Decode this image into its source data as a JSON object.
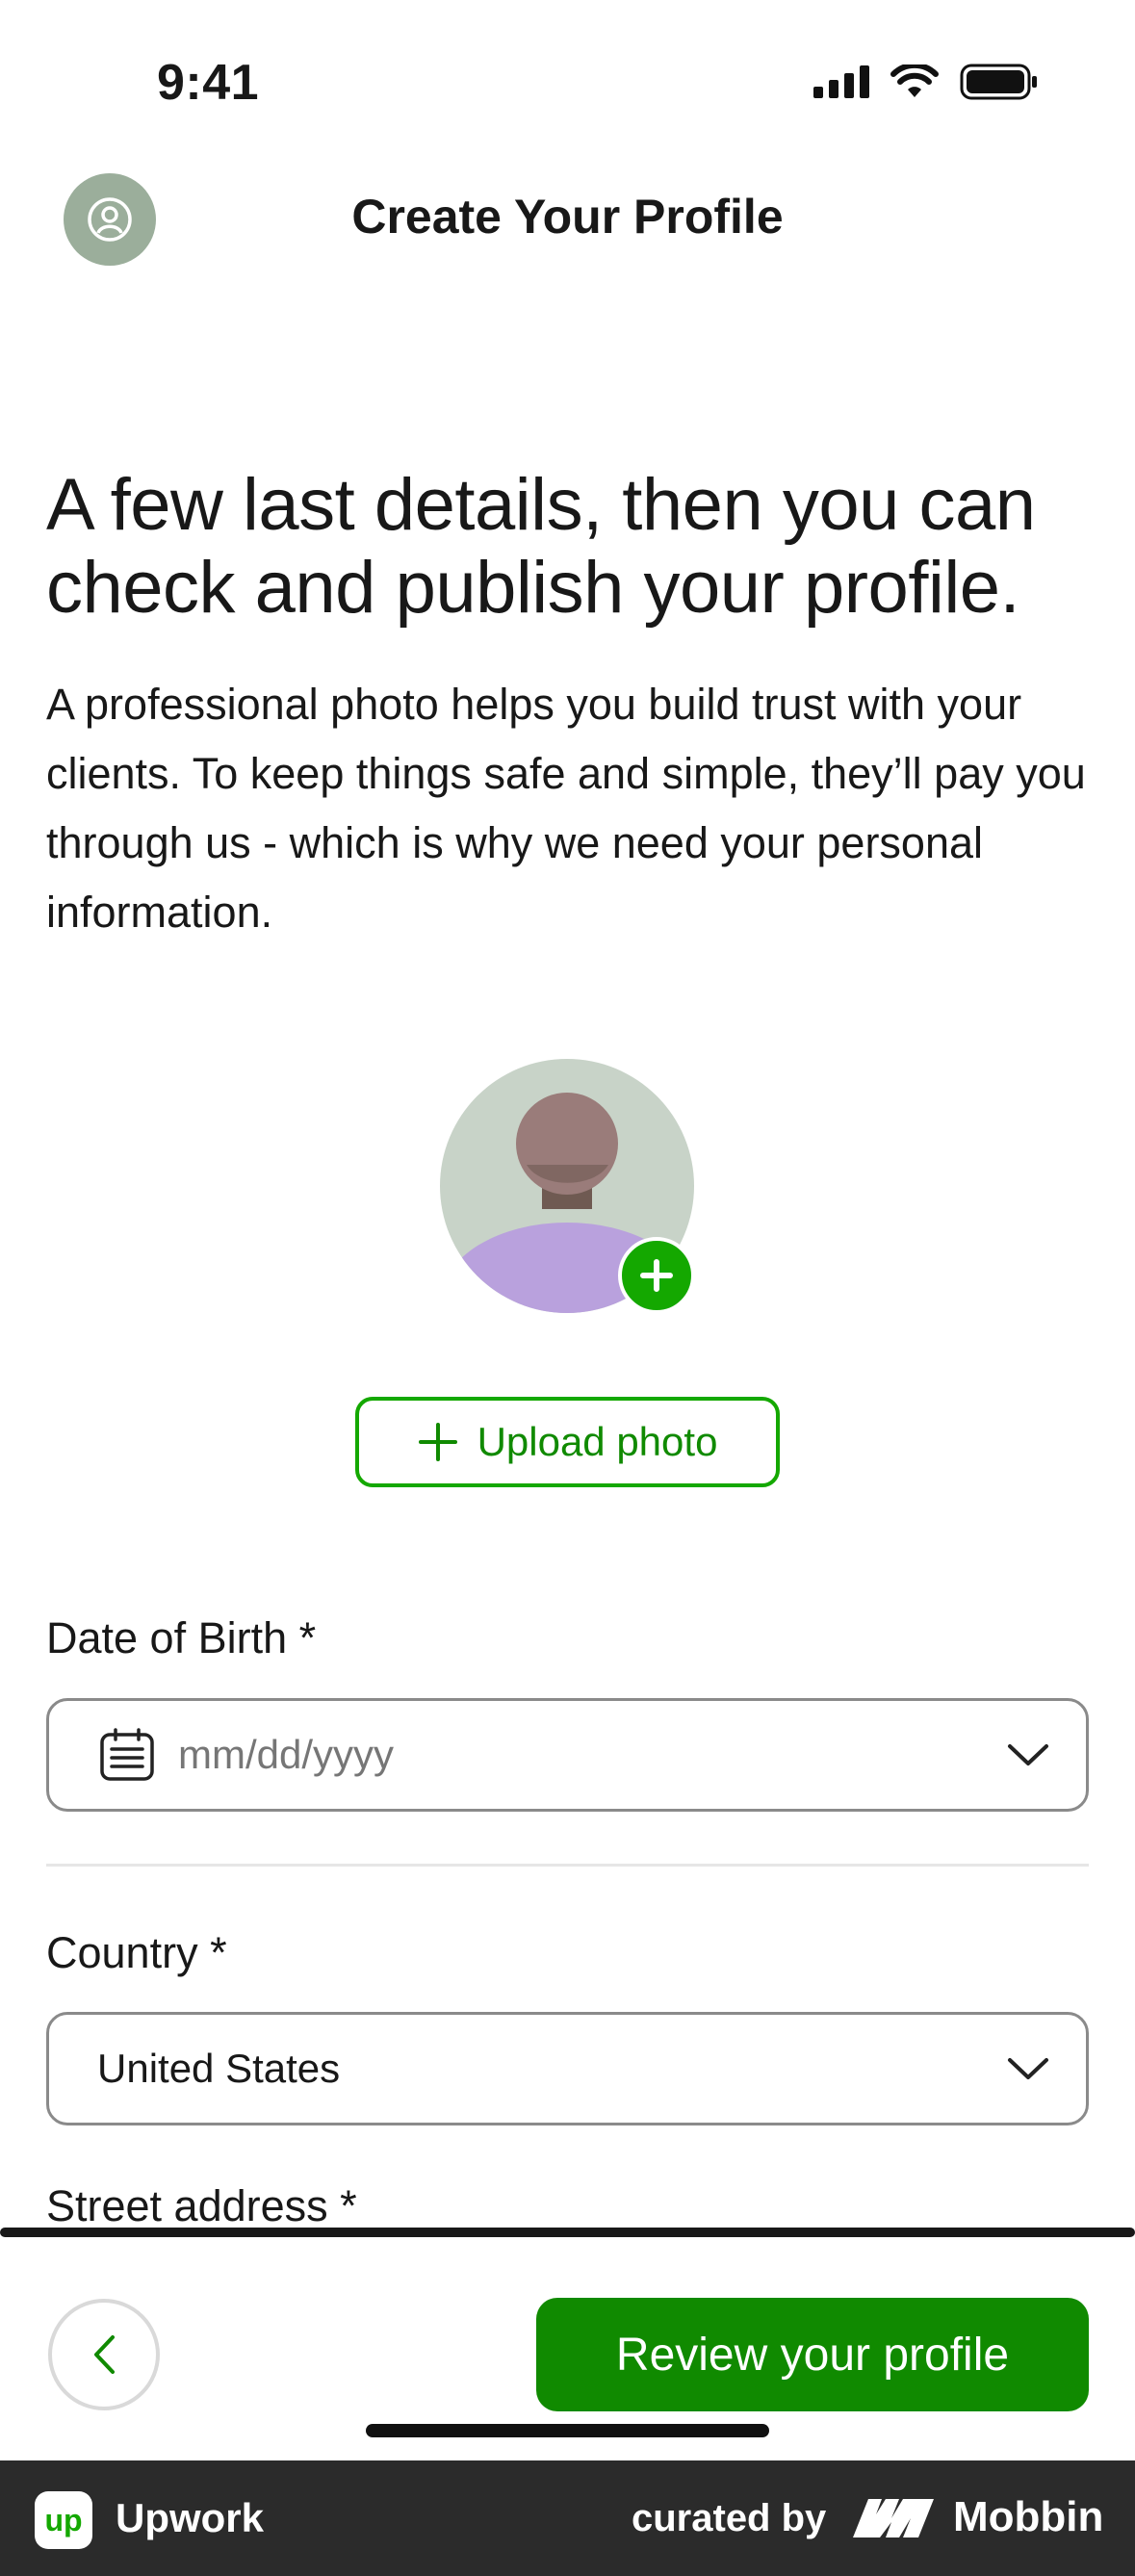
{
  "status_bar": {
    "time": "9:41"
  },
  "header": {
    "title": "Create Your Profile",
    "avatar_icon": "user-circle-icon"
  },
  "intro": {
    "headline": "A few last details, then you can check and publish your profile.",
    "body": "A professional photo helps you build trust with your clients. To keep things safe and simple, they’ll pay you through us - which is why we need your personal information."
  },
  "photo": {
    "upload_label": "Upload photo",
    "add_icon": "plus-icon"
  },
  "form": {
    "dob": {
      "label": "Date of Birth *",
      "placeholder": "mm/dd/yyyy",
      "icon": "calendar-icon"
    },
    "country": {
      "label": "Country *",
      "value": "United States"
    },
    "street": {
      "label": "Street address *"
    }
  },
  "actions": {
    "review_label": "Review your profile",
    "back_icon": "chevron-left-icon"
  },
  "footer": {
    "app_name": "Upwork",
    "app_logo_text": "up",
    "curated_by": "curated by",
    "brand": "Mobbin"
  },
  "colors": {
    "primary": "#14a800",
    "primary_dark": "#108a00",
    "footer_bg": "#2b2b2b"
  }
}
